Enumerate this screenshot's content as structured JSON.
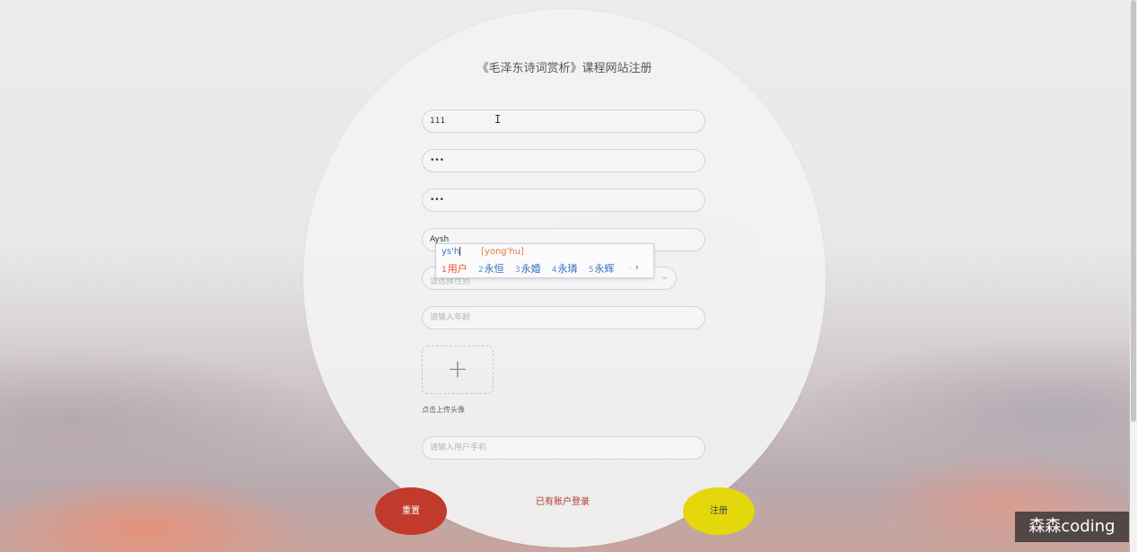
{
  "form": {
    "title": "《毛泽东诗词赏析》课程网站注册",
    "username_value": "111",
    "password_value": "•••",
    "confirm_password_value": "•••",
    "name_value": "Aysh",
    "select_placeholder": "请选择性别",
    "age_placeholder": "请输入年龄",
    "upload_label": "点击上传头像",
    "phone_placeholder": "请输入用户手机",
    "reset_label": "重置",
    "login_link": "已有账户登录",
    "submit_label": "注册"
  },
  "ime": {
    "composition": "ys'h",
    "pinyin": "[yong'hu]",
    "candidates": [
      {
        "n": "1",
        "text": "用户"
      },
      {
        "n": "2",
        "text": "永恒"
      },
      {
        "n": "3",
        "text": "永婚"
      },
      {
        "n": "4",
        "text": "永璘"
      },
      {
        "n": "5",
        "text": "永辉"
      }
    ],
    "prev_icon": "‹",
    "next_icon": "›"
  },
  "icons": {
    "upload": "plus-icon",
    "select": "chevron-down-icon",
    "cursor": "text-cursor-icon"
  },
  "colors": {
    "reset": "#c13a2b",
    "submit": "#e4d80d",
    "link": "#b03a30"
  },
  "watermark": "森森coding"
}
